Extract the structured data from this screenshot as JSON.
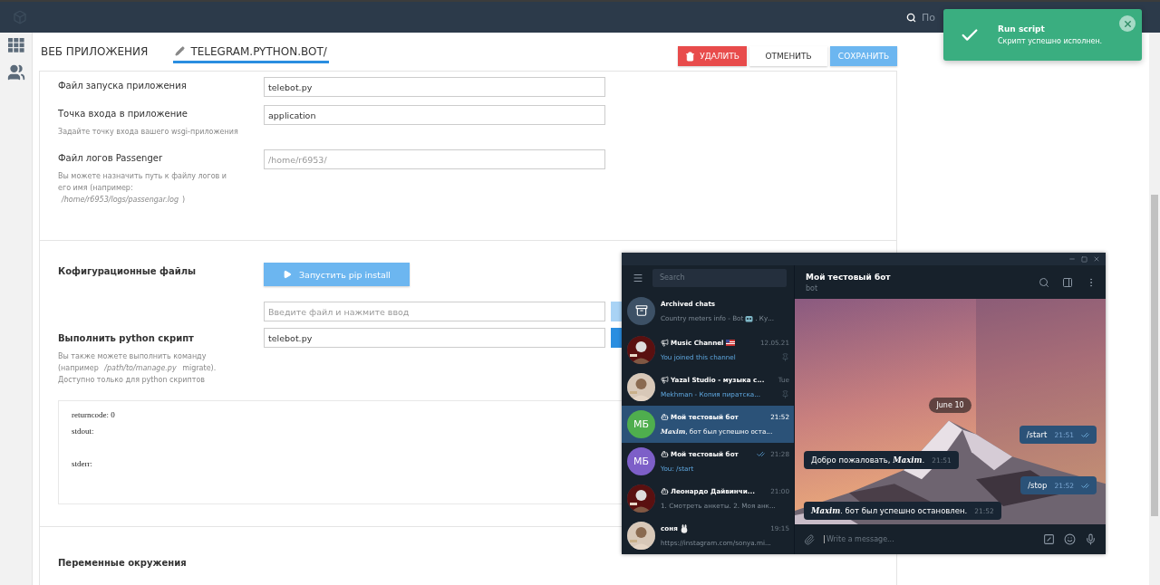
{
  "topbar": {
    "search_placeholder": "По"
  },
  "tabs": [
    {
      "label": "ВЕБ ПРИЛОЖЕНИЯ",
      "selected": false,
      "kind": "plain"
    },
    {
      "label": "TELEGRAM.PYTHON.BOT/",
      "selected": true,
      "kind": "edit"
    }
  ],
  "actions": [
    {
      "label": "УДАЛИТЬ",
      "kind": "danger"
    },
    {
      "label": "ОТМЕНИТЬ",
      "kind": "default"
    },
    {
      "label": "СОХРАНИТЬ",
      "kind": "primary"
    }
  ],
  "app_fields": [
    {
      "label": "Файл запуска приложения",
      "value": "telebot.py"
    },
    {
      "label": "Точка входа в приложение",
      "value": "application",
      "hint": "Задайте точку входа вашего wsgi-приложения"
    },
    {
      "label": "Файл логов Passenger",
      "placeholder": "/home/r6953/",
      "hint": "Вы можете назначить путь к файлу логов и его имя (например:  */home/r6953/logs/passengar.log*)"
    }
  ],
  "config": {
    "title": "Кофигурационные файлы",
    "pip_button": "Запустить pip install",
    "file_input": {
      "placeholder": "Введите файл и нажмите ввод"
    }
  },
  "script": {
    "title": "Выполнить python скрипт",
    "value": "telebot.py",
    "hint": "Вы также можете выполнить команду (например  */path/to/manage.py*  migrate). Доступно только для python скриптов",
    "output": {
      "returncode": "returncode: 0",
      "stdout": "stdout:",
      "stderr": "stderr:"
    }
  },
  "env": {
    "title": "Переменные окружения"
  },
  "toast": {
    "title": "Run script",
    "message": "Скрипт успешно исполнен."
  },
  "telegram": {
    "search_placeholder": "Search",
    "chats": [
      {
        "kind": "archive",
        "name": "Archived chats",
        "preview": "Country meters info - Bot",
        "preview_tail": ". Ку...",
        "selected": false
      },
      {
        "kind": "channel",
        "name": "Music Channel",
        "time": "12.05.21",
        "preview": "You joined this channel",
        "accent": true,
        "pinned": true,
        "flag": true,
        "selected": false
      },
      {
        "kind": "channel",
        "name": "Yazal Studio - музыка с...",
        "time": "Tue",
        "preview": "Mekhman - Копия пиратска...",
        "accent": true,
        "pinned": true,
        "selected": false
      },
      {
        "kind": "bot",
        "name": "Мой тестовый бот",
        "time": "21:52",
        "preview": "**Maxim**, бот был успешно оста...",
        "initials": "МБ",
        "color": "#4fae4e",
        "selected": true
      },
      {
        "kind": "bot",
        "name": "Мой тестовый бот",
        "time": "21:28",
        "preview": "You: /start",
        "initials": "МБ",
        "color": "#7d5fc8",
        "accent": true,
        "read": true,
        "selected": false
      },
      {
        "kind": "bot",
        "name": "Леонардо Дайвинчи...",
        "time": "21:00",
        "preview": "1. Смотреть анкеты. 2. Моя анк...",
        "selected": false
      },
      {
        "kind": "user",
        "name": "соня",
        "time": "19:15",
        "preview": "https://instagram.com/sonya.mi...",
        "bunny": true,
        "selected": false
      }
    ],
    "chat": {
      "title": "Мой тестовый бот",
      "subtitle": "bot",
      "date": "June 10",
      "messages": [
        {
          "kind": "out",
          "text": "/start",
          "time": "21:51",
          "read": true
        },
        {
          "kind": "in",
          "text": "Добро пожаловать, **Maxim**.",
          "time": "21:51"
        },
        {
          "kind": "out",
          "text": "/stop",
          "time": "21:52",
          "read": true
        },
        {
          "kind": "in",
          "text": "**Maxim**. бот был успешно остановлен.",
          "time": "21:52"
        }
      ],
      "input_placeholder": "Write a message..."
    }
  }
}
